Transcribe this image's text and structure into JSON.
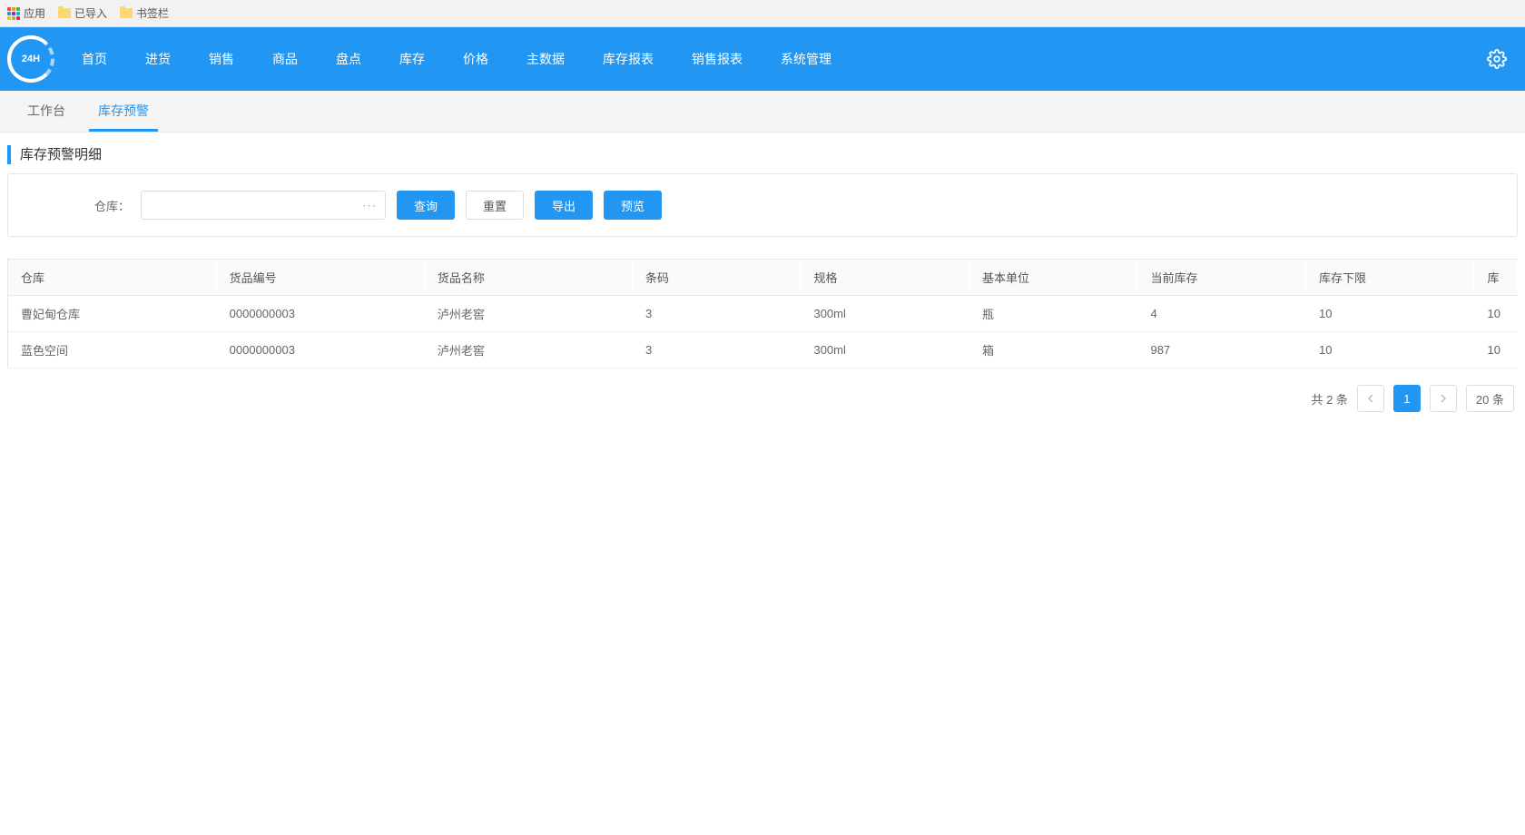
{
  "bookmarks": {
    "apps": "应用",
    "imported": "已导入",
    "bar": "书签栏"
  },
  "logo_text": "24H",
  "nav": {
    "items": [
      "首页",
      "进货",
      "销售",
      "商品",
      "盘点",
      "库存",
      "价格",
      "主数据",
      "库存报表",
      "销售报表",
      "系统管理"
    ]
  },
  "tabs": {
    "items": [
      {
        "label": "工作台",
        "active": false
      },
      {
        "label": "库存预警",
        "active": true
      }
    ]
  },
  "section_title": "库存预警明细",
  "filter": {
    "warehouse_label": "仓库：",
    "warehouse_value": "",
    "more": "···",
    "btn_query": "查询",
    "btn_reset": "重置",
    "btn_export": "导出",
    "btn_preview": "预览"
  },
  "table": {
    "headers": [
      "仓库",
      "货品编号",
      "货品名称",
      "条码",
      "规格",
      "基本单位",
      "当前库存",
      "库存下限",
      "库"
    ],
    "rows": [
      [
        "曹妃甸仓库",
        "0000000003",
        "泸州老窖",
        "3",
        "300ml",
        "瓶",
        "4",
        "10",
        "10"
      ],
      [
        "蓝色空间",
        "0000000003",
        "泸州老窖",
        "3",
        "300ml",
        "箱",
        "987",
        "10",
        "10"
      ]
    ]
  },
  "pager": {
    "total_text": "共 2 条",
    "current": "1",
    "page_size": "20 条"
  }
}
